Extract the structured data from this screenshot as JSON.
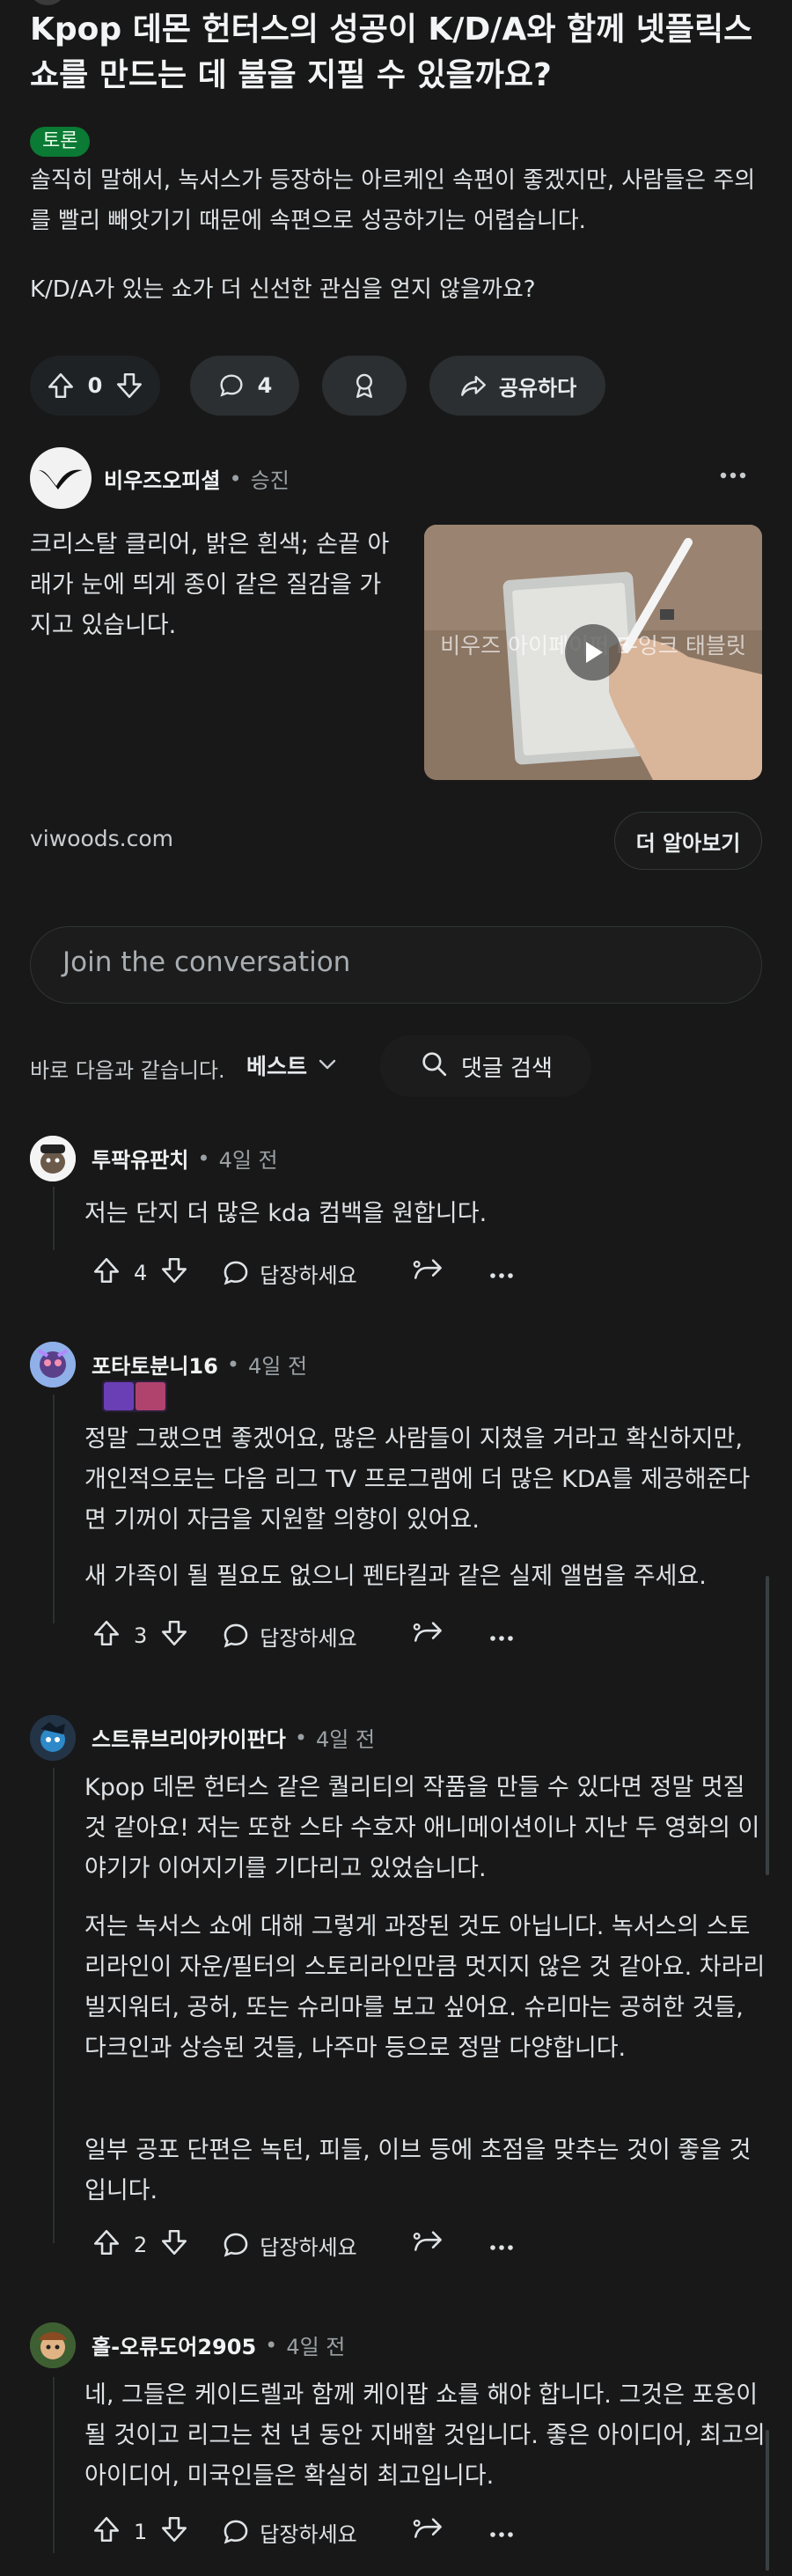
{
  "post": {
    "title": "Kpop 데몬 헌터스의 성공이 K/D/A와 함께 넷플릭스 쇼를 만드는 데 불을 지필 수 있을까요?",
    "flair": "토론",
    "body_p1": "솔직히 말해서, 녹서스가 등장하는 아르케인 속편이 좋겠지만, 사람들은 주의를 빨리 빼앗기기 때문에 속편으로 성공하기는 어렵습니다.",
    "body_p2": "K/D/A가 있는 쇼가 더 신선한 관심을 얻지 않을까요?",
    "votes": "0",
    "comments": "4",
    "share": "공유하다"
  },
  "ad": {
    "advertiser": "비우즈오피셜",
    "promoted": "승진",
    "text": "크리스탈 클리어, 밝은 흰색; 손끝 아래가 눈에 띄게 종이 같은 질감을 가지고 있습니다.",
    "video_caption": "비우즈 아이페이퍼 E-잉크 태블릿",
    "domain": "viwoods.com",
    "cta": "더 알아보기"
  },
  "composer": {
    "placeholder": "Join the conversation"
  },
  "sort": {
    "label": "바로 다음과 같습니다.",
    "value": "베스트",
    "search": "댓글 검색"
  },
  "comments": [
    {
      "user": "투팍유판치",
      "time": "4일 전",
      "p": [
        "저는 단지 더 많은 kda 컴백을 원합니다."
      ],
      "votes": "4",
      "reply": "답장하세요"
    },
    {
      "user": "포타토분니16",
      "time": "4일 전",
      "p": [
        "정말 그랬으면 좋겠어요, 많은 사람들이 지쳤을 거라고 확신하지만, 개인적으로는 다음 리그 TV 프로그램에 더 많은 KDA를 제공해준다면 기꺼이 자금을 지원할 의향이 있어요.",
        "새 가족이 될 필요도 없으니 펜타킬과 같은 실제 앨범을 주세요."
      ],
      "votes": "3",
      "reply": "답장하세요"
    },
    {
      "user": "스트류브리아카이판다",
      "time": "4일 전",
      "p": [
        "Kpop 데몬 헌터스 같은 퀄리티의 작품을 만들 수 있다면 정말 멋질 것 같아요! 저는 또한 스타 수호자 애니메이션이나 지난 두 영화의 이야기가 이어지기를 기다리고 있었습니다.",
        "저는 녹서스 쇼에 대해 그렇게 과장된 것도 아닙니다. 녹서스의 스토리라인이 자운/필터의 스토리라인만큼 멋지지 않은 것 같아요. 차라리 빌지워터, 공허, 또는 슈리마를 보고 싶어요. 슈리마는 공허한 것들, 다크인과 상승된 것들, 나주마 등으로 정말 다양합니다.",
        "일부 공포 단편은 녹턴, 피들, 이브 등에 초점을 맞추는 것이 좋을 것입니다."
      ],
      "votes": "2",
      "reply": "답장하세요"
    },
    {
      "user": "홀-오류도어2905",
      "time": "4일 전",
      "p": [
        "네, 그들은 케이드렐과 함께 케이팝 쇼를 해야 합니다. 그것은 포옹이 될 것이고 리그는 천 년 동안 지배할 것입니다. 좋은 아이디어, 최고의 아이디어, 미국인들은 확실히 최고입니다."
      ],
      "votes": "1",
      "reply": "답장하세요"
    }
  ],
  "colors": {
    "background": "#181818",
    "pill": "#2b2f31",
    "flair": "#0a7a34"
  }
}
